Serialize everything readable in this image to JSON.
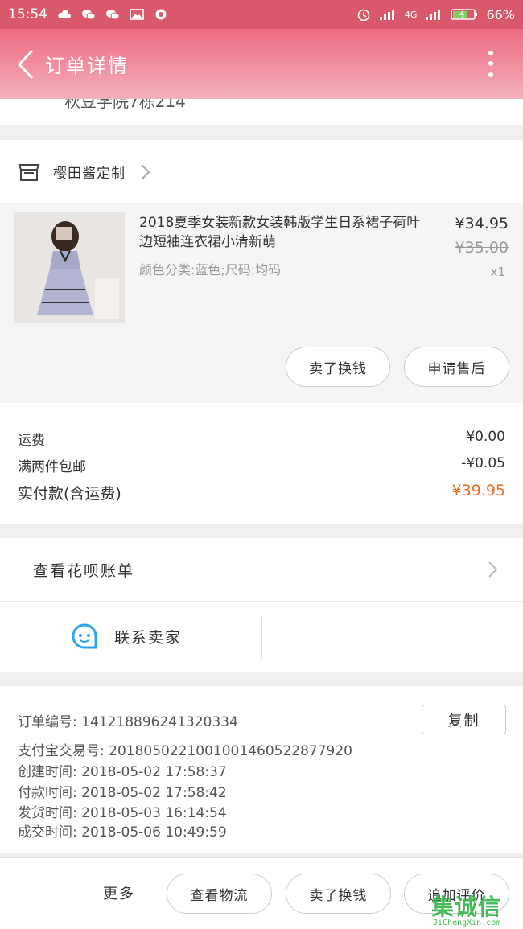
{
  "status_bar": {
    "time": "15:54",
    "network": "4G",
    "battery": "66%"
  },
  "nav": {
    "title": "订单详情"
  },
  "address": {
    "partial_line": "秋豆学院7栋214"
  },
  "shop": {
    "name": "樱田酱定制"
  },
  "item": {
    "title": "2018夏季女装新款女装韩版学生日系裙子荷叶边短袖连衣裙小清新萌",
    "spec": "颜色分类:蓝色;尺码:均码",
    "price": "¥34.95",
    "original_price": "¥35.00",
    "quantity": "x1",
    "buttons": [
      "卖了换钱",
      "申请售后"
    ]
  },
  "fees": {
    "shipping_label": "运费",
    "shipping_value": "¥0.00",
    "discount_label": "满两件包邮",
    "discount_value": "-¥0.05",
    "total_label": "实付款(含运费)",
    "total_value": "¥39.95"
  },
  "huabei": {
    "label": "查看花呗账单"
  },
  "contact": {
    "label": "联系卖家"
  },
  "order_info": {
    "order_no": "订单编号:  141218896241320334",
    "alipay_no": "支付宝交易号:  2018050221001001460522877920",
    "created": "创建时间:  2018-05-02 17:58:37",
    "paid": "付款时间:  2018-05-02 17:58:42",
    "shipped": "发货时间:  2018-05-03 16:14:54",
    "completed": "成交时间:  2018-05-06 10:49:59",
    "copy_label": "复制"
  },
  "bottom_bar": {
    "more_label": "更多",
    "buttons": [
      "查看物流",
      "卖了换钱",
      "追加评价"
    ]
  },
  "watermark": {
    "main": "集诚信",
    "sub": "JiChengXin.com"
  },
  "colors": {
    "accent": "#ee6a80",
    "price_highlight": "#f26b21",
    "contact_icon": "#2aa3f2"
  }
}
